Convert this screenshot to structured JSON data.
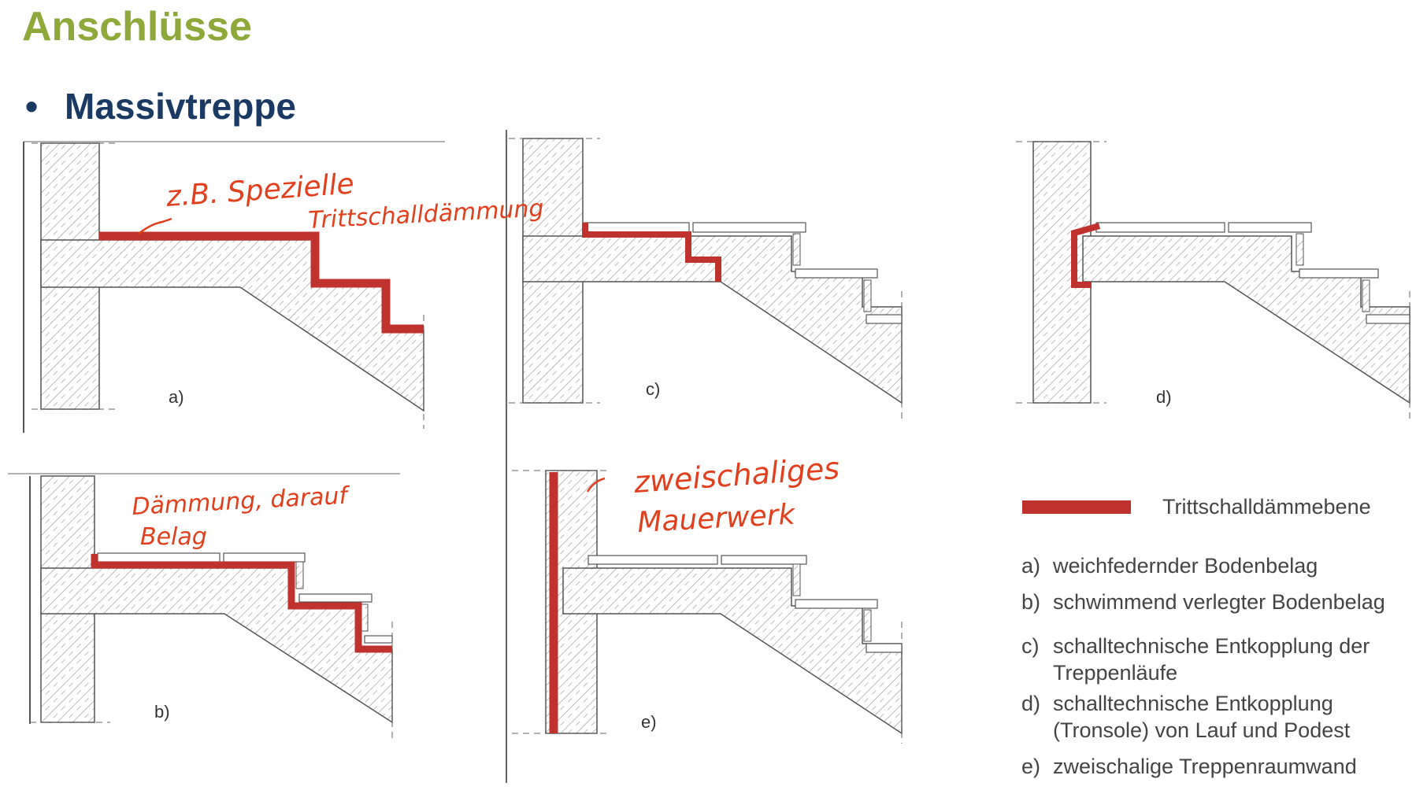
{
  "page": {
    "title": "Anschlüsse",
    "bullet": "Massivtreppe"
  },
  "figures": {
    "a": "a)",
    "b": "b)",
    "c": "c)",
    "d": "d)",
    "e": "e)"
  },
  "annotations": {
    "a_line1": "z.B. Spezielle",
    "a_line2": "Trittschalldämmung",
    "b_line1": "Dämmung, darauf",
    "b_line2": "Belag",
    "e_line1": "zweischaliges",
    "e_line2": "Mauerwerk"
  },
  "legend": {
    "swatch_label": "Trittschalldämmebene",
    "items": [
      {
        "key": "a)",
        "text": "weichfedernder Bodenbelag"
      },
      {
        "key": "b)",
        "text": "schwimmend verlegter Bodenbelag"
      },
      {
        "key": "c)",
        "text": "schalltechnische Entkopplung der",
        "text2": "Treppenläufe"
      },
      {
        "key": "d)",
        "text": "schalltechnische Entkopplung",
        "text2": "(Tronsole) von Lauf und Podest"
      },
      {
        "key": "e)",
        "text": "zweischalige Treppenraumwand"
      }
    ]
  },
  "colors": {
    "title": "#8ea83a",
    "bullet": "#1b3a63",
    "insulation": "#c0322e",
    "handwriting": "#e0401e"
  }
}
